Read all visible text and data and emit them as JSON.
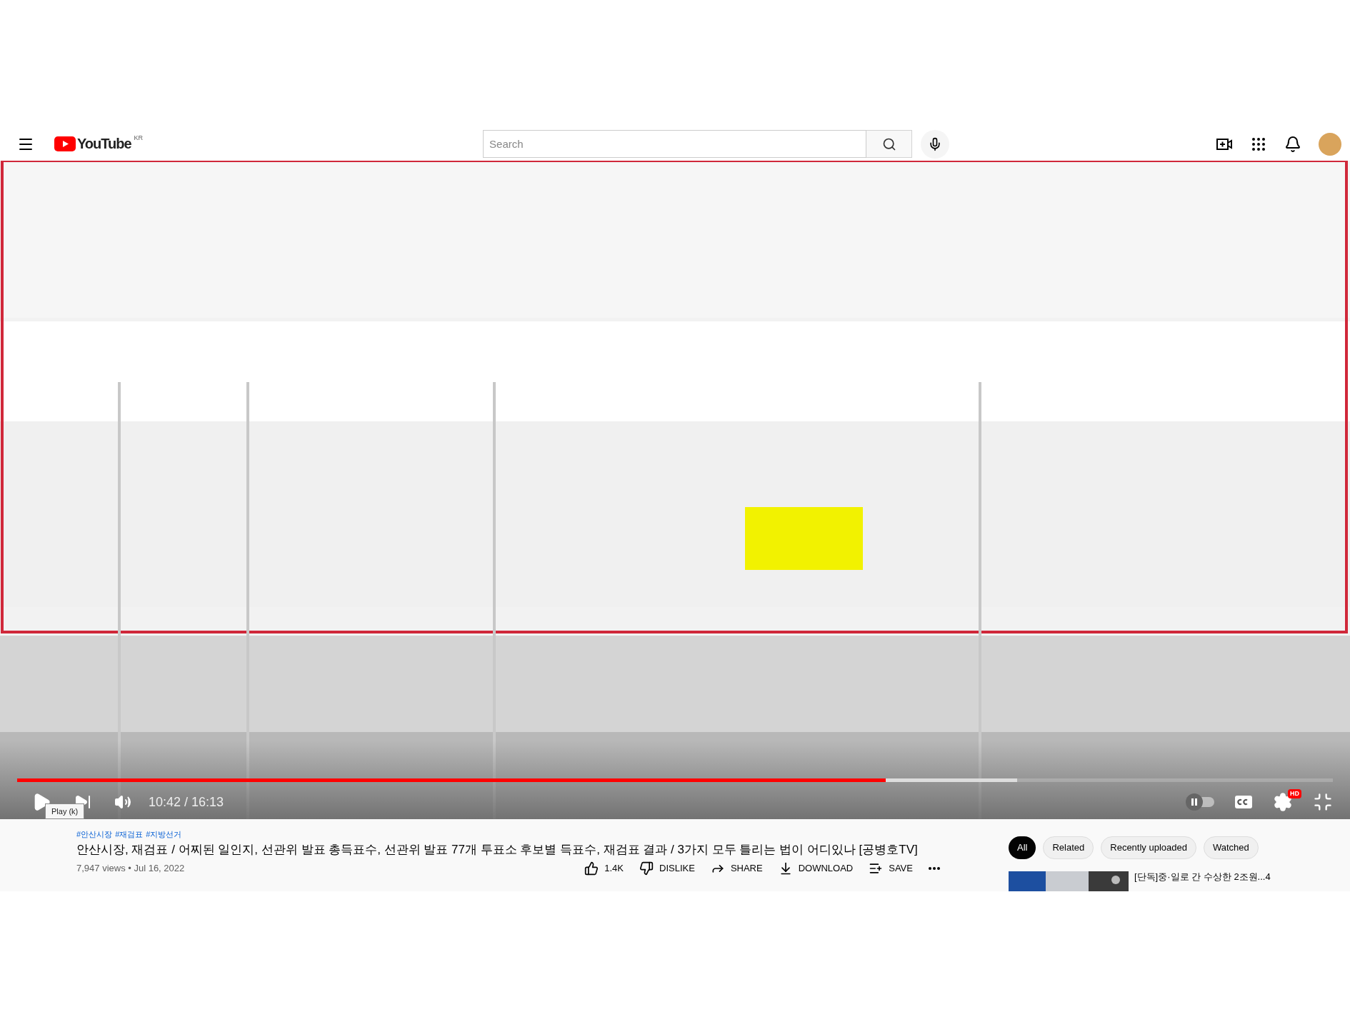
{
  "header": {
    "logo": "YouTube",
    "country": "KR",
    "search": {
      "placeholder": "Search"
    }
  },
  "player": {
    "played": {
      "level": 0.66
    },
    "buffered": {
      "level": 0.76
    },
    "time": "10:42 / 16:13",
    "tooltip": "Play (k)",
    "hd_badge": "HD",
    "autoplay": {
      "on": false
    }
  },
  "video": {
    "hashtags": [
      "#안산시장",
      "#재검표",
      "#지방선거"
    ],
    "title": "안산시장, 재검표 / 어찌된 일인지, 선관위 발표 총득표수, 선관위 발표 77개 투표소 후보별 득표수, 재검표 결과 / 3가지 모두 틀리는 법이 어디있나 [공병호TV]",
    "meta": "7,947 views • Jul 16, 2022",
    "actions": [
      {
        "kind": "like",
        "label": "1.4K"
      },
      {
        "kind": "dislike",
        "label": "DISLIKE"
      },
      {
        "kind": "share",
        "label": "SHARE"
      },
      {
        "kind": "download",
        "label": "DOWNLOAD"
      },
      {
        "kind": "save",
        "label": "SAVE"
      },
      {
        "kind": "more"
      }
    ]
  },
  "chips": [
    {
      "label": "All",
      "selected": true
    },
    {
      "label": "Related",
      "selected": false
    },
    {
      "label": "Recently uploaded",
      "selected": false
    },
    {
      "label": "Watched",
      "selected": false
    }
  ],
  "related": [
    {
      "title": "[단독]중·일로 간 수상한 2조원...4"
    }
  ]
}
